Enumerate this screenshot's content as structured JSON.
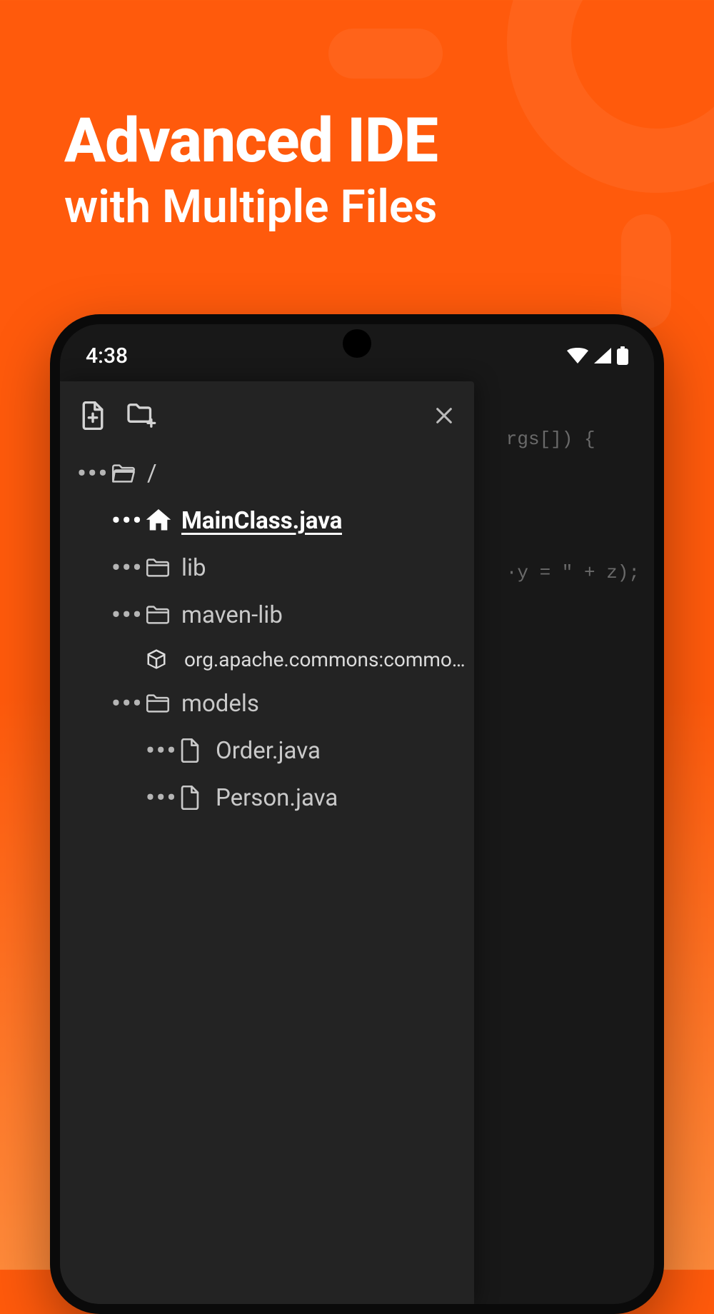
{
  "headline": {
    "line1": "Advanced IDE",
    "line2": "with Multiple Files"
  },
  "status": {
    "time": "4:38"
  },
  "tree": {
    "root_label": "/",
    "items": [
      {
        "name": "MainClass.java",
        "type": "home",
        "active": true
      },
      {
        "name": "lib",
        "type": "folder"
      },
      {
        "name": "maven-lib",
        "type": "folder"
      },
      {
        "name": "org.apache.commons:commo…",
        "type": "package"
      },
      {
        "name": "models",
        "type": "folder"
      },
      {
        "name": "Order.java",
        "type": "file"
      },
      {
        "name": "Person.java",
        "type": "file"
      }
    ]
  },
  "code_snippet": {
    "line1": "rgs[]) {",
    "line2": "·y = \" + z);"
  }
}
